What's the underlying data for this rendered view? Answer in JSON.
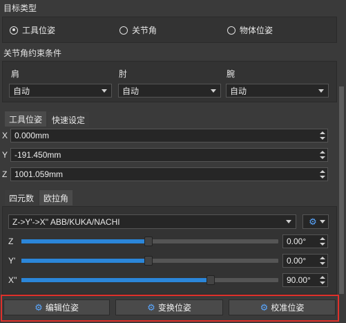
{
  "target_type": {
    "title": "目标类型",
    "options": [
      {
        "label": "工具位姿",
        "checked": true
      },
      {
        "label": "关节角",
        "checked": false
      },
      {
        "label": "物体位姿",
        "checked": false
      }
    ]
  },
  "joint_constraints": {
    "title": "关节角约束条件",
    "columns": [
      {
        "label": "肩",
        "value": "自动"
      },
      {
        "label": "肘",
        "value": "自动"
      },
      {
        "label": "腕",
        "value": "自动"
      }
    ]
  },
  "pose_tabs": [
    "工具位姿",
    "快速设定"
  ],
  "position": [
    {
      "axis": "X",
      "value": "0.000mm"
    },
    {
      "axis": "Y",
      "value": "-191.450mm"
    },
    {
      "axis": "Z",
      "value": "1001.059mm"
    }
  ],
  "rotation_tabs": [
    "四元数",
    "欧拉角"
  ],
  "euler": {
    "convention": "Z->Y'->X'' ABB/KUKA/NACHI",
    "sliders": [
      {
        "axis": "Z",
        "value": "0.00°",
        "level": 0.5
      },
      {
        "axis": "Y'",
        "value": "0.00°",
        "level": 0.5
      },
      {
        "axis": "X''",
        "value": "90.00°",
        "level": 0.75
      }
    ]
  },
  "actions": [
    {
      "label": "编辑位姿",
      "icon": "gear-icon"
    },
    {
      "label": "变换位姿",
      "icon": "gear-icon"
    },
    {
      "label": "校准位姿",
      "icon": "gear-icon"
    }
  ],
  "colors": {
    "accent": "#2b86d9",
    "highlight_box": "#e0302b"
  }
}
